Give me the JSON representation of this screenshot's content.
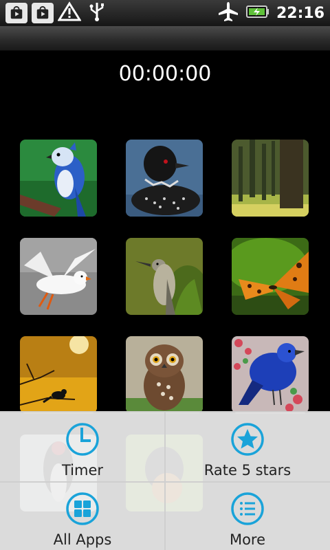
{
  "status_bar": {
    "time": "22:16",
    "notification_icons": [
      "play-store-icon",
      "play-store-icon",
      "warning-icon",
      "usb-icon"
    ],
    "right_icons": [
      "airplane-mode-icon",
      "battery-charging-icon"
    ]
  },
  "timer": {
    "value": "00:00:00"
  },
  "grid": {
    "tiles": [
      "blue-jay-image",
      "loon-image",
      "forest-image",
      "seagull-image",
      "mockingbird-image",
      "butterfly-image",
      "bird-moon-image",
      "owl-image",
      "indigo-bunting-image",
      "woodpecker-image",
      "oriole-image"
    ]
  },
  "menu": {
    "items": [
      {
        "label": "Timer",
        "icon": "clock-icon"
      },
      {
        "label": "Rate 5 stars",
        "icon": "star-icon"
      },
      {
        "label": "All Apps",
        "icon": "grid-icon"
      },
      {
        "label": "More",
        "icon": "list-icon"
      }
    ],
    "accent_color": "#1aa3d9"
  }
}
